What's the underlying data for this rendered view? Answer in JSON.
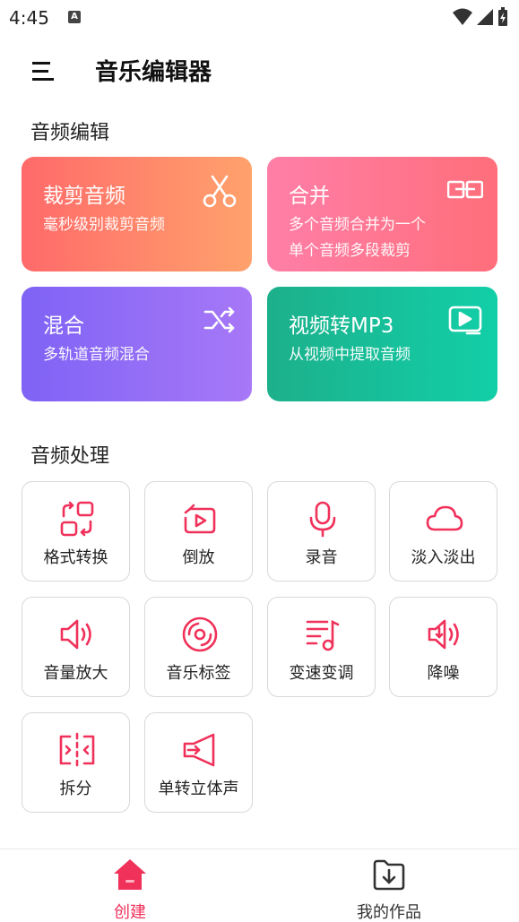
{
  "status_bar": {
    "time": "4:45",
    "indicator": "A"
  },
  "app_bar": {
    "title": "音乐编辑器"
  },
  "sections": {
    "edit_title": "音频编辑",
    "process_title": "音频处理"
  },
  "cards": [
    {
      "title": "裁剪音频",
      "desc": "毫秒级别裁剪音频",
      "icon": "scissors-icon"
    },
    {
      "title": "合并",
      "desc": "多个音频合并为一个\n单个音频多段裁剪",
      "icon": "merge-icon"
    },
    {
      "title": "混合",
      "desc": "多轨道音频混合",
      "icon": "shuffle-icon"
    },
    {
      "title": "视频转MP3",
      "desc": "从视频中提取音频",
      "icon": "video-to-audio-icon"
    }
  ],
  "tools": [
    {
      "label": "格式转换",
      "icon": "format-convert-icon"
    },
    {
      "label": "倒放",
      "icon": "reverse-play-icon"
    },
    {
      "label": "录音",
      "icon": "microphone-icon"
    },
    {
      "label": "淡入淡出",
      "icon": "cloud-icon"
    },
    {
      "label": "音量放大",
      "icon": "volume-up-icon"
    },
    {
      "label": "音乐标签",
      "icon": "music-tag-icon"
    },
    {
      "label": "变速变调",
      "icon": "playlist-note-icon"
    },
    {
      "label": "降噪",
      "icon": "noise-reduction-icon"
    },
    {
      "label": "拆分",
      "icon": "split-icon"
    },
    {
      "label": "单转立体声",
      "icon": "stereo-icon"
    }
  ],
  "bottom_nav": [
    {
      "label": "创建",
      "icon": "home-icon",
      "active": true
    },
    {
      "label": "我的作品",
      "icon": "folder-download-icon",
      "active": false
    }
  ],
  "colors": {
    "accent": "#f0315a",
    "nav_inactive": "#333333"
  }
}
